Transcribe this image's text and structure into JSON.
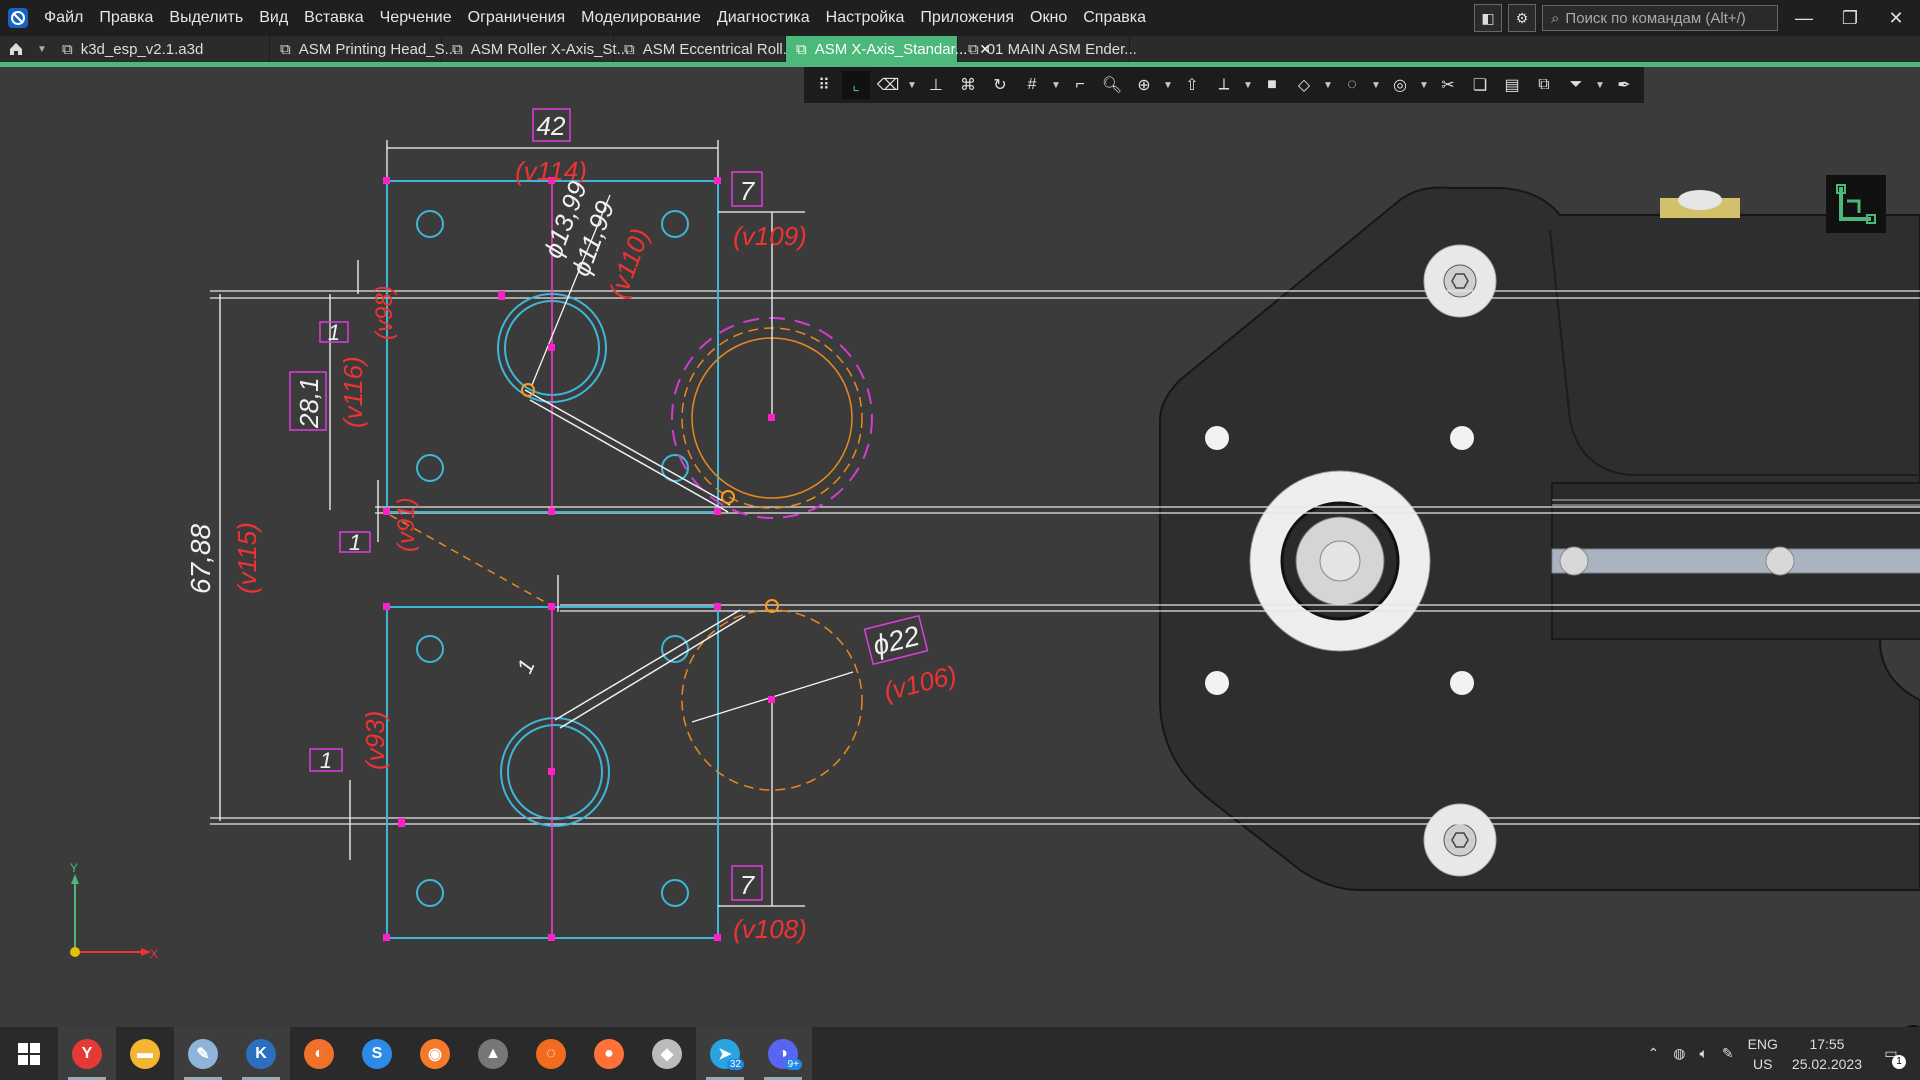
{
  "menubar": {
    "items": [
      "Файл",
      "Правка",
      "Выделить",
      "Вид",
      "Вставка",
      "Черчение",
      "Ограничения",
      "Моделирование",
      "Диагностика",
      "Настройка",
      "Приложения",
      "Окно",
      "Справка"
    ],
    "search_placeholder": "Поиск по командам (Alt+/)"
  },
  "tabs": [
    {
      "label": "k3d_esp_v2.1.a3d",
      "active": false
    },
    {
      "label": "ASM Printing Head_S...",
      "active": false
    },
    {
      "label": "ASM Roller X-Axis_St...",
      "active": false
    },
    {
      "label": "ASM Eccentrical Roll...",
      "active": false
    },
    {
      "label": "ASM X-Axis_Standar...",
      "active": true
    },
    {
      "label": "01 MAIN ASM Ender...",
      "active": false
    }
  ],
  "drawing": {
    "dims": {
      "d42": "42",
      "v114": "(v114)",
      "d7_top": "7",
      "v109": "(v109)",
      "d13_99": "ϕ13,99",
      "d11_99": "ϕ11,99",
      "v110": "(v110)",
      "d1_a": "1",
      "v98": "(v98)",
      "d28_1": "28,1",
      "v116": "(v116)",
      "d67_88": "67,88",
      "v115": "(v115)",
      "d1_b": "1",
      "v91": "(v91)",
      "d1_mid": "1",
      "d22": "ϕ22",
      "v106": "(v106)",
      "d1_c": "1",
      "v93": "(v93)",
      "d7_bot": "7",
      "v108": "(v108)"
    },
    "axis_y": "Y",
    "axis_x": "X"
  },
  "taskbar": {
    "apps": [
      {
        "name": "yandex-browser",
        "glyph": "Y",
        "color": "#e53935"
      },
      {
        "name": "file-explorer",
        "glyph": "▬",
        "color": "#f2b632"
      },
      {
        "name": "paint",
        "glyph": "✎",
        "color": "#8fb3d9"
      },
      {
        "name": "kompas-3d",
        "glyph": "K",
        "color": "#2c6fbf"
      },
      {
        "name": "app-orange",
        "glyph": "◐",
        "color": "#f0712a"
      },
      {
        "name": "app-s",
        "glyph": "S",
        "color": "#2b8be6"
      },
      {
        "name": "blender",
        "glyph": "◉",
        "color": "#f5792a"
      },
      {
        "name": "app-tank",
        "glyph": "▲",
        "color": "#777777"
      },
      {
        "name": "app-ring",
        "glyph": "◌",
        "color": "#f26b1f"
      },
      {
        "name": "firefox",
        "glyph": "●",
        "color": "#ff7139"
      },
      {
        "name": "app-hat",
        "glyph": "◆",
        "color": "#bbbbbb"
      },
      {
        "name": "telegram",
        "glyph": "➤",
        "color": "#2aa3e0",
        "badge": "32"
      },
      {
        "name": "discord",
        "glyph": "◑",
        "color": "#5865f2",
        "badge": "9+"
      }
    ],
    "lang_top": "ENG",
    "lang_bottom": "US",
    "time": "17:55",
    "date": "25.02.2023",
    "notification_count": "1"
  }
}
